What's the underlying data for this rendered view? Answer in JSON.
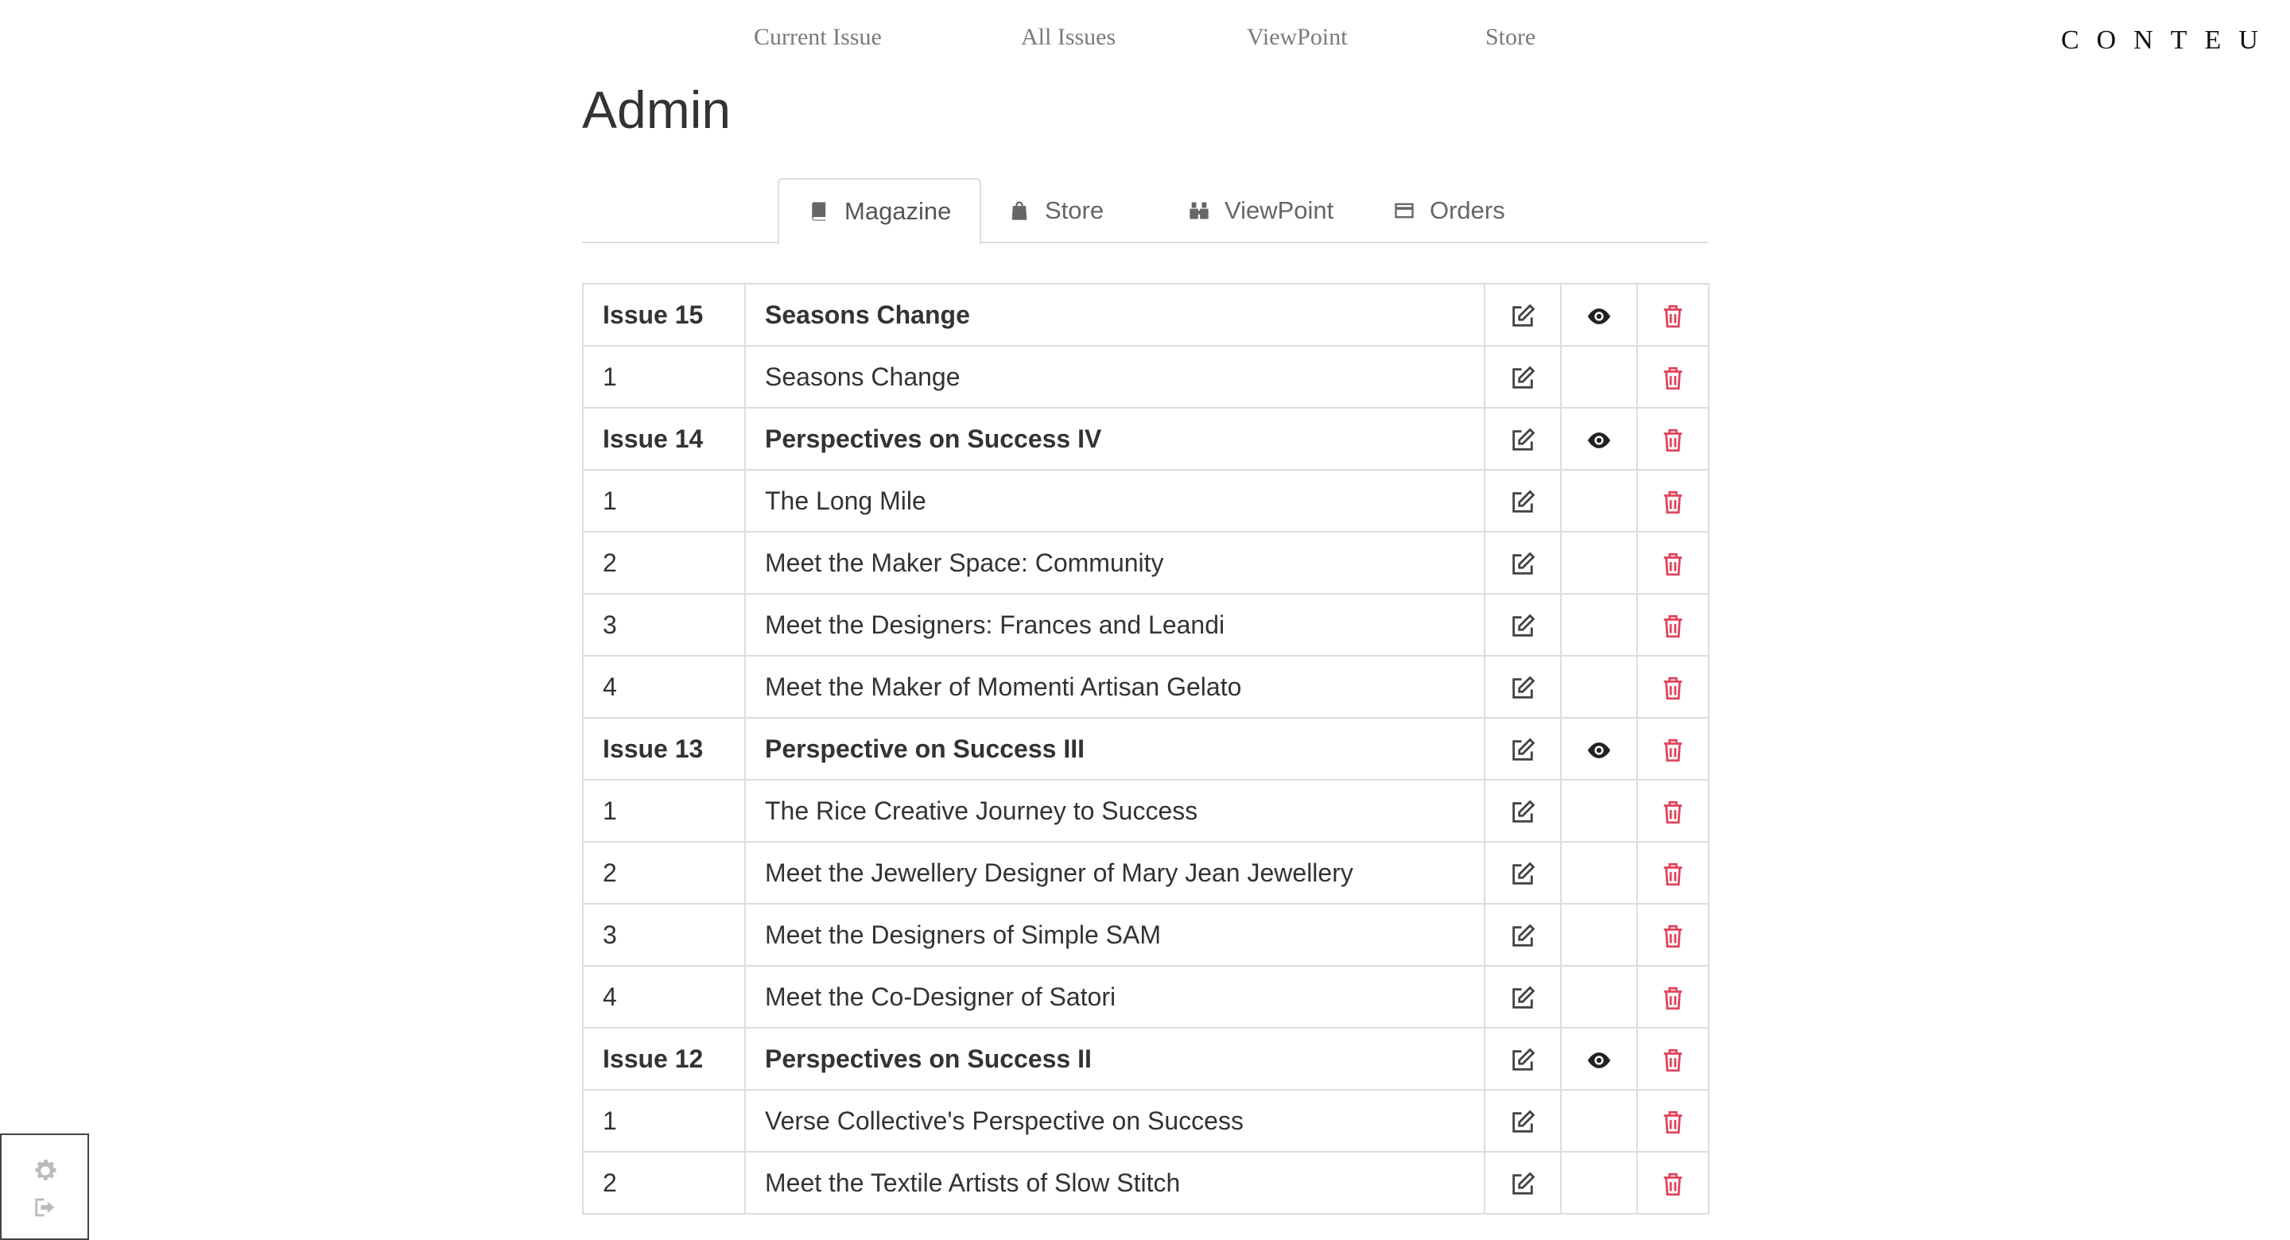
{
  "nav": {
    "items": [
      "Current Issue",
      "All Issues",
      "ViewPoint",
      "Store"
    ],
    "logo": "CONTEU"
  },
  "page": {
    "title": "Admin"
  },
  "tabs": [
    {
      "label": "Magazine",
      "icon": "book-icon",
      "active": true
    },
    {
      "label": "Store",
      "icon": "shopping-bag-icon",
      "active": false
    },
    {
      "label": "ViewPoint",
      "icon": "binoculars-icon",
      "active": false
    },
    {
      "label": "Orders",
      "icon": "credit-card-icon",
      "active": false
    }
  ],
  "colors": {
    "delete": "#e0455a",
    "border": "#dddddd",
    "text": "#333333"
  },
  "rows": [
    {
      "num": "Issue 15",
      "title": "Seasons Change",
      "issue": true
    },
    {
      "num": "1",
      "title": "Seasons Change",
      "issue": false
    },
    {
      "num": "Issue 14",
      "title": "Perspectives on Success IV",
      "issue": true
    },
    {
      "num": "1",
      "title": "The Long Mile",
      "issue": false
    },
    {
      "num": "2",
      "title": "Meet the Maker Space: Community",
      "issue": false
    },
    {
      "num": "3",
      "title": "Meet the Designers: Frances and Leandi",
      "issue": false
    },
    {
      "num": "4",
      "title": "Meet the Maker of Momenti Artisan Gelato",
      "issue": false
    },
    {
      "num": "Issue 13",
      "title": "Perspective on Success III",
      "issue": true
    },
    {
      "num": "1",
      "title": "The Rice Creative Journey to Success",
      "issue": false
    },
    {
      "num": "2",
      "title": "Meet the Jewellery Designer of Mary Jean Jewellery",
      "issue": false
    },
    {
      "num": "3",
      "title": "Meet the Designers of Simple SAM",
      "issue": false
    },
    {
      "num": "4",
      "title": "Meet the Co-Designer of Satori",
      "issue": false
    },
    {
      "num": "Issue 12",
      "title": "Perspectives on Success II",
      "issue": true
    },
    {
      "num": "1",
      "title": "Verse Collective's Perspective on Success",
      "issue": false
    },
    {
      "num": "2",
      "title": "Meet the Textile Artists of Slow Stitch",
      "issue": false
    }
  ]
}
